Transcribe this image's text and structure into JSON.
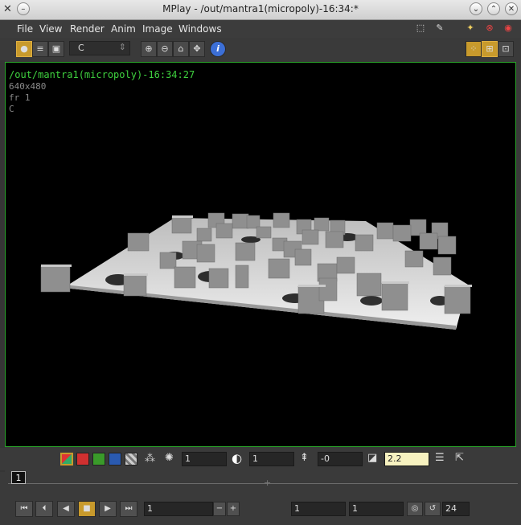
{
  "window": {
    "title": "MPlay - /out/mantra1(micropoly)-16:34:*"
  },
  "menu": [
    "File",
    "View",
    "Render",
    "Anim",
    "Image",
    "Windows"
  ],
  "toolbar": {
    "channel": "C"
  },
  "overlay": {
    "path": "/out/mantra1(micropoly)-16:34:27",
    "resolution": "640x480",
    "frame": "fr 1",
    "channel": "C"
  },
  "controls": {
    "exposure": "1",
    "brightness": "1",
    "offset": "-0",
    "gamma": "2.2"
  },
  "timeline": {
    "current_frame": "1"
  },
  "playback": {
    "frame_field": "1",
    "range_start": "1",
    "range_end": "1",
    "fps": "24"
  }
}
